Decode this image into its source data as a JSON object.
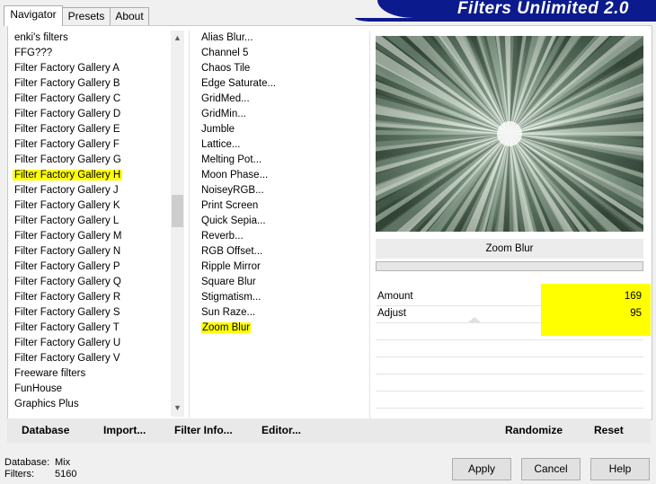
{
  "tabs": [
    "Navigator",
    "Presets",
    "About"
  ],
  "banner_title": "Filters Unlimited 2.0",
  "categories": [
    "enki's filters",
    "FFG???",
    "Filter Factory Gallery A",
    "Filter Factory Gallery B",
    "Filter Factory Gallery C",
    "Filter Factory Gallery D",
    "Filter Factory Gallery E",
    "Filter Factory Gallery F",
    "Filter Factory Gallery G",
    "Filter Factory Gallery H",
    "Filter Factory Gallery J",
    "Filter Factory Gallery K",
    "Filter Factory Gallery L",
    "Filter Factory Gallery M",
    "Filter Factory Gallery N",
    "Filter Factory Gallery P",
    "Filter Factory Gallery Q",
    "Filter Factory Gallery R",
    "Filter Factory Gallery S",
    "Filter Factory Gallery T",
    "Filter Factory Gallery U",
    "Filter Factory Gallery V",
    "Freeware filters",
    "FunHouse",
    "Graphics Plus"
  ],
  "selected_category": "Filter Factory Gallery H",
  "filters": [
    "Alias Blur...",
    "Channel 5",
    "Chaos Tile",
    "Edge Saturate...",
    "GridMed...",
    "GridMin...",
    "Jumble",
    "Lattice...",
    "Melting Pot...",
    "Moon Phase...",
    "NoiseyRGB...",
    "Print Screen",
    "Quick Sepia...",
    "Reverb...",
    "RGB Offset...",
    "Ripple Mirror",
    "Square Blur",
    "Stigmatism...",
    "Sun Raze...",
    "Zoom Blur"
  ],
  "selected_filter": "Zoom Blur",
  "current_filter_name": "Zoom Blur",
  "params": [
    {
      "label": "Amount",
      "value": "169"
    },
    {
      "label": "Adjust",
      "value": "95"
    }
  ],
  "toolbar": {
    "database": "Database",
    "import": "Import...",
    "filter_info": "Filter Info...",
    "editor": "Editor...",
    "randomize": "Randomize",
    "reset": "Reset"
  },
  "status": {
    "database_label": "Database:",
    "database_value": "Mix",
    "filters_label": "Filters:",
    "filters_value": "5160"
  },
  "buttons": {
    "apply": "Apply",
    "cancel": "Cancel",
    "help": "Help"
  },
  "colors": {
    "highlight": "#ffff00",
    "banner": "#0b1a8c"
  }
}
